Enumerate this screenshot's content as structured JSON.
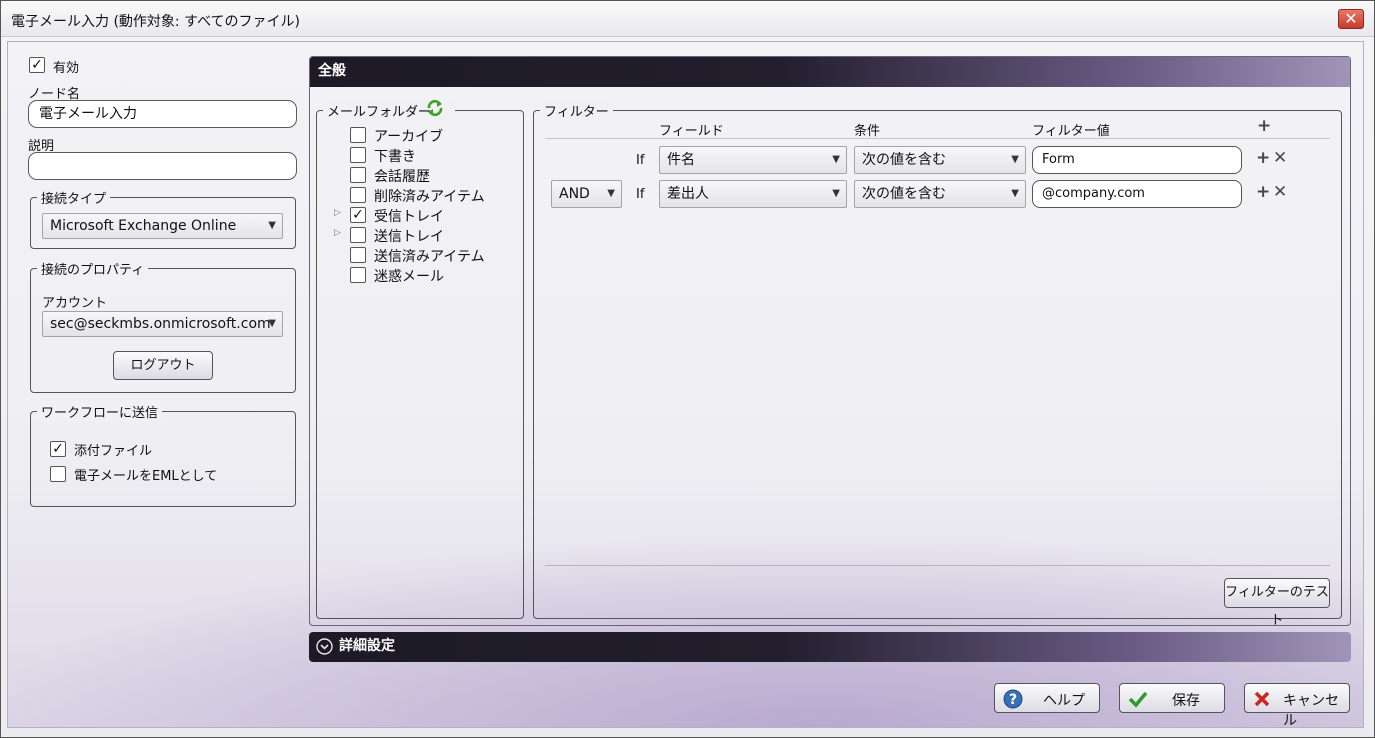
{
  "window": {
    "title": "電子メール入力 (動作対象: すべてのファイル)",
    "close_glyph": "✕"
  },
  "left": {
    "enabled_label": "有効",
    "enabled_checked": true,
    "node_name_label": "ノード名",
    "node_name_value": "電子メール入力",
    "description_label": "説明",
    "description_value": "",
    "connection_type": {
      "title": "接続タイプ",
      "selected": "Microsoft Exchange Online"
    },
    "connection_props": {
      "title": "接続のプロパティ",
      "account_label": "アカウント",
      "account_value": "sec@seckmbs.onmicrosoft.com",
      "logout_label": "ログアウト"
    },
    "workflow": {
      "title": "ワークフローに送信",
      "attachments_label": "添付ファイル",
      "attachments_checked": true,
      "eml_label": "電子メールをEMLとして",
      "eml_checked": false
    }
  },
  "general": {
    "header": "全般",
    "mail_folder": {
      "title": "メールフォルダー",
      "folders": [
        {
          "label": "アーカイブ",
          "checked": false,
          "expandable": false
        },
        {
          "label": "下書き",
          "checked": false,
          "expandable": false
        },
        {
          "label": "会話履歴",
          "checked": false,
          "expandable": false
        },
        {
          "label": "削除済みアイテム",
          "checked": false,
          "expandable": false
        },
        {
          "label": "受信トレイ",
          "checked": true,
          "expandable": true
        },
        {
          "label": "送信トレイ",
          "checked": false,
          "expandable": true
        },
        {
          "label": "送信済みアイテム",
          "checked": false,
          "expandable": false
        },
        {
          "label": "迷惑メール",
          "checked": false,
          "expandable": false
        }
      ]
    },
    "filter": {
      "title": "フィルター",
      "col_field": "フィールド",
      "col_condition": "条件",
      "col_value": "フィルター値",
      "add_glyph": "+",
      "rows": [
        {
          "logic": "",
          "if": "If",
          "field": "件名",
          "condition": "次の値を含む",
          "value": "Form"
        },
        {
          "logic": "AND",
          "if": "If",
          "field": "差出人",
          "condition": "次の値を含む",
          "value": "@company.com"
        }
      ],
      "test_label": "フィルターのテスト"
    }
  },
  "advanced": {
    "header": "詳細設定"
  },
  "footer": {
    "help": "ヘルプ",
    "save": "保存",
    "cancel": "キャンセル"
  },
  "colors": {
    "accent_dark": "#1d1a26",
    "accent_purple": "#a095b8",
    "save_check": "#2e9a2e",
    "cancel_x": "#c9261c",
    "help_blue": "#3b6fb5"
  },
  "icons": {
    "refresh": "refresh-icon",
    "expand": "expand-icon",
    "help": "help-icon",
    "save": "check-icon",
    "cancel": "x-icon"
  }
}
